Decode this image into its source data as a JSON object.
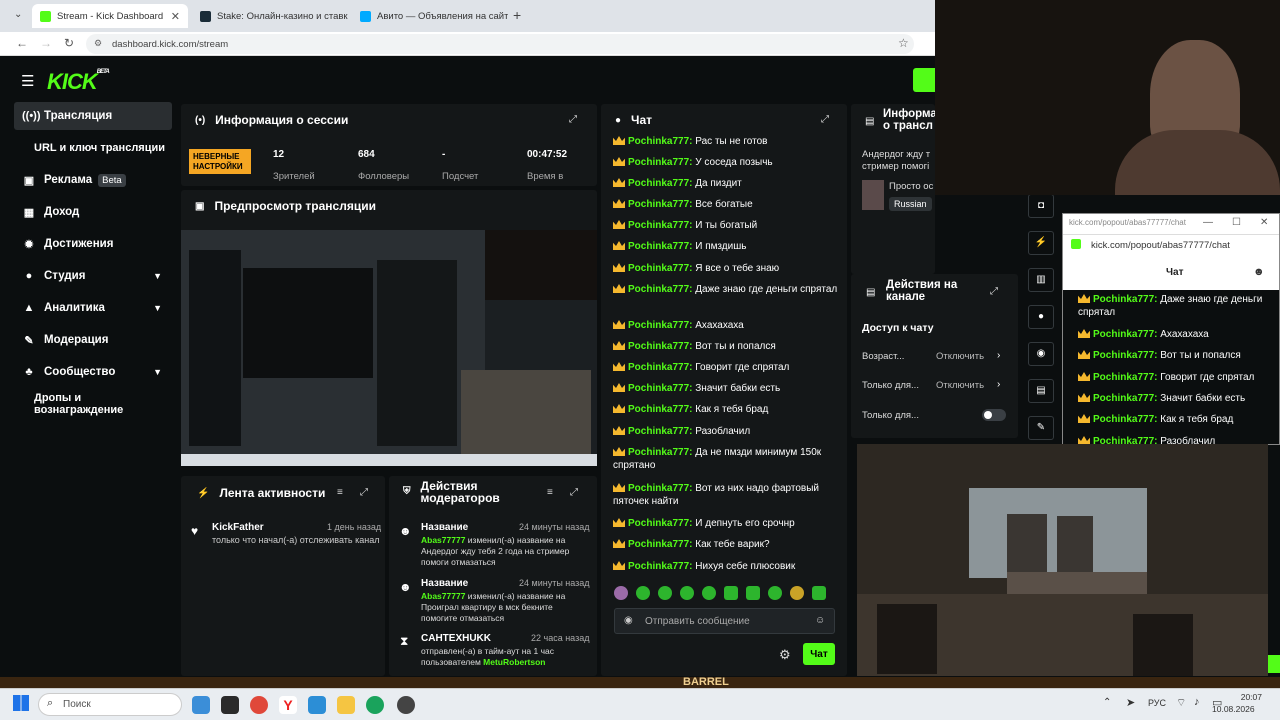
{
  "browser": {
    "tabs": [
      {
        "title": "Stream - Kick Dashboard",
        "color": "#53fc18"
      },
      {
        "title": "Stake: Онлайн-казино и ставк",
        "color": "#1a2c38"
      },
      {
        "title": "Авито — Объявления на сайте",
        "color": "#00aaff"
      }
    ],
    "url": "dashboard.kick.com/stream"
  },
  "sidebar": {
    "items": [
      {
        "label": "Трансляция",
        "icon": "broadcast-icon"
      },
      {
        "label": "URL и ключ трансляции"
      },
      {
        "label": "Реклама",
        "badge": "Beta",
        "icon": "ad-icon"
      },
      {
        "label": "Доход",
        "icon": "wallet-icon"
      },
      {
        "label": "Достижения",
        "icon": "badge-icon"
      },
      {
        "label": "Студия",
        "icon": "palette-icon"
      },
      {
        "label": "Аналитика",
        "icon": "chart-icon"
      },
      {
        "label": "Модерация",
        "icon": "wrench-icon"
      },
      {
        "label": "Сообщество",
        "icon": "community-icon"
      },
      {
        "label": "Дропы и вознаграждение"
      }
    ]
  },
  "session": {
    "title": "Информация о сессии",
    "warning": "НЕВЕРНЫЕ НАСТРОЙКИ",
    "stats": [
      {
        "value": "12",
        "label": "Зрителей"
      },
      {
        "value": "684",
        "label": "Фолловеры"
      },
      {
        "value": "-",
        "label": "Подсчет"
      },
      {
        "value": "00:47:52",
        "label": "Время в"
      }
    ]
  },
  "preview": {
    "title": "Предпросмотр трансляции"
  },
  "activity": {
    "title": "Лента активности",
    "items": [
      {
        "user": "KickFather",
        "time": "1 день назад",
        "text": "только что начал(-а) отслеживать канал"
      }
    ]
  },
  "modactions": {
    "title": "Действия модераторов",
    "items": [
      {
        "type": "Название",
        "time": "24 минуты назад",
        "user": "Abas77777",
        "text": "изменил(-а) название на Андердог жду тебя 2 года на стример помоги отмазаться"
      },
      {
        "type": "Название",
        "time": "24 минуты назад",
        "user": "Abas77777",
        "text": "изменил(-а) название на Проиграл квартиру в мск бекните помогите отмазаться"
      },
      {
        "type": "CAHTEXHUKK",
        "time": "22 часа назад",
        "user": "",
        "text": "отправлен(-а) в тайм-аут на 1 час пользователем",
        "target": "MetuRobertson"
      }
    ]
  },
  "chat": {
    "title": "Чат",
    "messages": [
      {
        "user": "Pochinka777:",
        "text": "Рас ты не готов"
      },
      {
        "user": "Pochinka777:",
        "text": "У соседа позычь"
      },
      {
        "user": "Pochinka777:",
        "text": "Да пиздит"
      },
      {
        "user": "Pochinka777:",
        "text": "Все богатые"
      },
      {
        "user": "Pochinka777:",
        "text": "И ты богатый"
      },
      {
        "user": "Pochinka777:",
        "text": "И пмздишь"
      },
      {
        "user": "Pochinka777:",
        "text": "Я все о тебе знаю"
      },
      {
        "user": "Pochinka777:",
        "text": "Даже знаю где деньги спрятал"
      },
      {
        "user": "Pochinka777:",
        "text": "Ахахахаха"
      },
      {
        "user": "Pochinka777:",
        "text": "Вот ты и попался"
      },
      {
        "user": "Pochinka777:",
        "text": "Говорит где спрятал"
      },
      {
        "user": "Pochinka777:",
        "text": "Значит бабки есть"
      },
      {
        "user": "Pochinka777:",
        "text": "Как я тебя брад"
      },
      {
        "user": "Pochinka777:",
        "text": "Разоблачил"
      },
      {
        "user": "Pochinka777:",
        "text": "Да не пмзди минимум 150к спрятано"
      },
      {
        "user": "Pochinka777:",
        "text": "Вот из них надо фартовый пяточек найти"
      },
      {
        "user": "Pochinka777:",
        "text": "И депнуть его срочнр"
      },
      {
        "user": "Pochinka777:",
        "text": "Как тебе варик?"
      },
      {
        "user": "Pochinka777:",
        "text": "Нихуя себе плюсовик"
      }
    ],
    "input_placeholder": "Отправить сообщение",
    "send_label": "Чат"
  },
  "streaminfo": {
    "title": "Информа о трансл",
    "text": "Андердог жду т стример помогі",
    "item": "Просто ос",
    "lang": "Russian"
  },
  "channelactions": {
    "title": "Действия на канале",
    "section": "Доступ к чату",
    "rows": [
      {
        "label": "Возраст...",
        "value": "Отключить"
      },
      {
        "label": "Только для...",
        "value": "Отключить"
      },
      {
        "label": "Только для...",
        "value": ""
      }
    ]
  },
  "popout": {
    "url": "kick.com/popout/abas77777/chat",
    "title": "Чат",
    "messages": [
      {
        "user": "Pochinka777:",
        "text": "Даже знаю где деньги спрятал"
      },
      {
        "user": "Pochinka777:",
        "text": "Ахахахаха"
      },
      {
        "user": "Pochinka777:",
        "text": "Вот ты и попался"
      },
      {
        "user": "Pochinka777:",
        "text": "Говорит где спрятал"
      },
      {
        "user": "Pochinka777:",
        "text": "Значит бабки есть"
      },
      {
        "user": "Pochinka777:",
        "text": "Как я тебя брад"
      },
      {
        "user": "Pochinka777:",
        "text": "Разоблачил"
      }
    ]
  },
  "taskbar": {
    "search": "Поиск",
    "lang": "РУС",
    "time": "20:07",
    "date": "10.08.2026",
    "banner": "BARREL"
  },
  "colors": {
    "accent": "#53fc18",
    "warning": "#f5a623",
    "panel": "#141718"
  }
}
